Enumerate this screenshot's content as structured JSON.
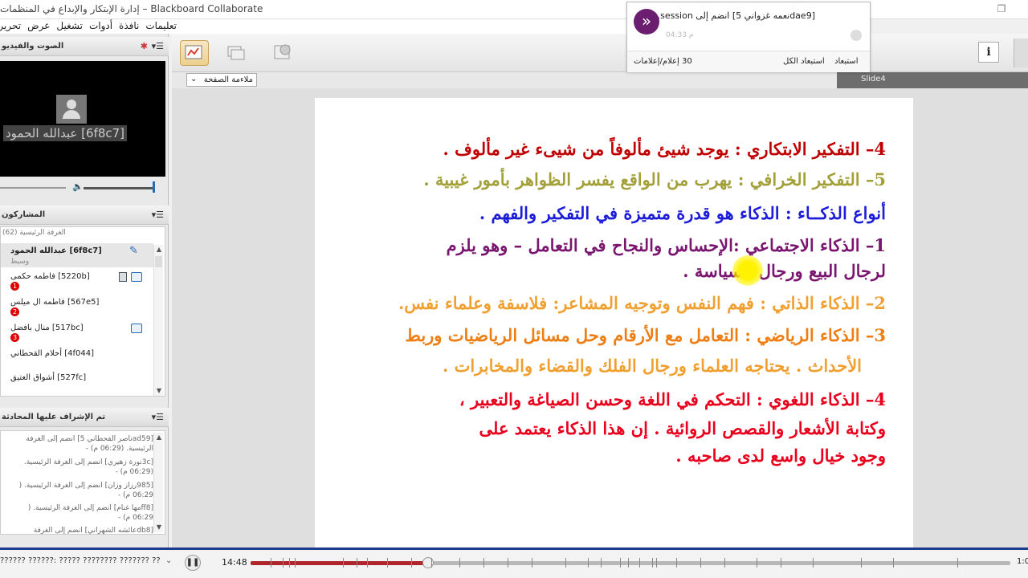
{
  "window": {
    "title": "إدارة الإبتكار والإبداع في المنظمات – Blackboard Collaborate"
  },
  "menu": [
    "تحرير",
    "عرض",
    "تشغيل",
    "أدوات",
    "نافذة",
    "تعليمات"
  ],
  "audio_video": {
    "panel_title": "الصوت والفيديو",
    "video_name": "عبدالله الحمود [6f8c7]"
  },
  "participants": {
    "panel_title": "المشاركون",
    "room_label": "الغرفة الرئيسية",
    "room_count": "(62)",
    "rows": [
      {
        "name": "عبدالله الحمود [6f8c7]",
        "role": "وسيط",
        "badge": ""
      },
      {
        "name": "فاطمه حكمى [5220b]",
        "role": "",
        "badge": "1"
      },
      {
        "name": "فاطمه ال ميلس [567e5]",
        "role": "",
        "badge": "2"
      },
      {
        "name": "منال بافضل [517bc]",
        "role": "",
        "badge": "3"
      },
      {
        "name": "أحلام القحطاني [4f044]",
        "role": "",
        "badge": ""
      },
      {
        "name": "أشواق العتيق [527fc]",
        "role": "",
        "badge": ""
      }
    ]
  },
  "chat": {
    "panel_title": "تم الإشراف عليها المحادثة",
    "lines": [
      "[ad59ناصر القحطاني 5] انضم إلى الغرفة",
      "الرئيسية. (06:29 م) -",
      "[3cنورة زهيري] انضم إلى الغرفة الرئيسية.",
      "(06:29 م) -",
      "[985رزاز وزان] انضم إلى الغرفة الرئيسية. (",
      "06:29 م) -",
      "[ff8مها غنام] انضم إلى الغرفة الرئيسية. (",
      "06:29 م) -",
      "[db8عائشه الشهراني] انضم إلى الغرفة"
    ]
  },
  "stage": {
    "fit_label": "ملاءمة الصفحة",
    "slide_tab": "Slide4"
  },
  "slide": {
    "lines": [
      {
        "text": "4– التفكير الابتكاري : يوجد شيئ مألوفاً من شيىء غير مألوف .",
        "color": "red"
      },
      {
        "text": "5– التفكير الخرافي : يهرب من الواقع يفسر الظواهر بأمور غيبية .",
        "color": "olive"
      },
      {
        "text": "أنواع الذكــاء : الذكاء هو قدرة متميزة في التفكير والفهم .",
        "color": "blue"
      },
      {
        "text": "1– الذكاء الاجتماعي :الإحساس والنجاح في التعامل – وهو يلزم",
        "color": "purple"
      },
      {
        "text": "لرجال البيع ورجال السياسة .",
        "color": "purple"
      },
      {
        "text": "2– الذكاء الذاتي : فهم النفس وتوجيه المشاعر: فلاسفة وعلماء نفس.",
        "color": "orange"
      },
      {
        "text": "3– الذكاء الرياضي : التعامل مع الأرقام وحل مسائل الرياضيات وربط",
        "color": "orange2"
      },
      {
        "text": "الأحداث . يحتاجه العلماء ورجال الفلك والقضاء والمخابرات .",
        "color": "orange"
      },
      {
        "text": "4– الذكاء اللغوي : التحكم في اللغة وحسن الصياغة والتعبير ،",
        "color": "red2"
      },
      {
        "text": "وكتابة الأشعار والقصص الروائية . إن هذا الذكاء يعتمد على",
        "color": "red2"
      },
      {
        "text": "وجود خيال واسع لدى صاحبه .",
        "color": "red2"
      }
    ]
  },
  "notification": {
    "text": "[dae9نعمه غزواني 5] انضم إلى session.",
    "time": "04:33 م",
    "dismiss": "استبعاد",
    "dismiss_all": "استبعاد الكل",
    "count_label": "30 إعلام/إعلامات"
  },
  "playback": {
    "status_text": "?????? ??????: ????? ???????? ??????? ??",
    "pause_icon": "pause-icon",
    "time": "14:48",
    "end": "1:0",
    "progress": 0.234
  },
  "colors": {
    "accent": "#1f3b8f",
    "progress": "#b0242c",
    "notify_icon": "#6b1d6f"
  }
}
